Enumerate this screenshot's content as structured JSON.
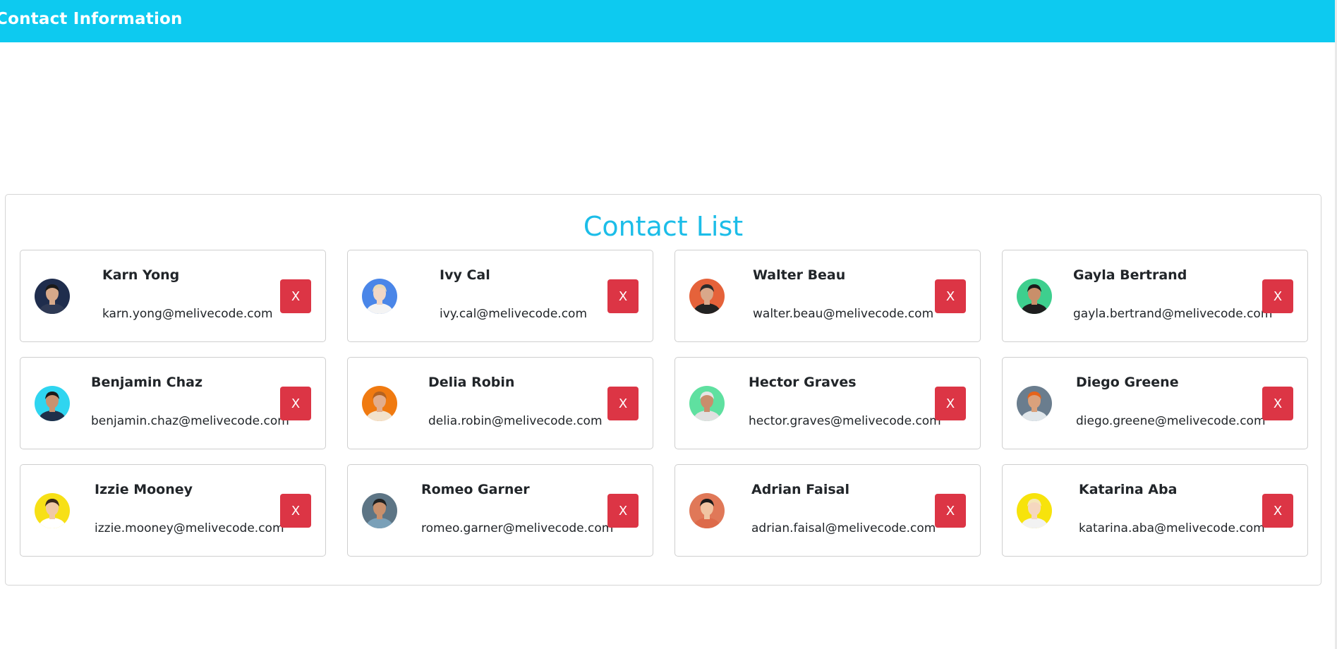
{
  "header": {
    "title": "Contact Information",
    "bg_color": "#0dcaf0"
  },
  "panel": {
    "title": "Contact List",
    "title_color": "#1cbde8"
  },
  "delete_label": "X",
  "delete_color": "#dc3545",
  "contacts": [
    {
      "name": "Karn Yong",
      "email": "karn.yong@melivecode.com",
      "avatar_bg": "#1f2d4d",
      "skin": "#d7a98a",
      "hair": "#1a1a1a",
      "shirt": "#2f3a55"
    },
    {
      "name": "Ivy Cal",
      "email": "ivy.cal@melivecode.com",
      "avatar_bg": "#4a86e8",
      "skin": "#f1d7c6",
      "hair": "#e8d9b8",
      "shirt": "#f4f4f4"
    },
    {
      "name": "Walter Beau",
      "email": "walter.beau@melivecode.com",
      "avatar_bg": "#e5623a",
      "skin": "#d9a88a",
      "hair": "#2b2b2b",
      "shirt": "#222222"
    },
    {
      "name": "Gayla Bertrand",
      "email": "gayla.bertrand@melivecode.com",
      "avatar_bg": "#3ecf8e",
      "skin": "#c98f6a",
      "hair": "#1b1b1b",
      "shirt": "#1e1e1e"
    },
    {
      "name": "Benjamin Chaz",
      "email": "benjamin.chaz@melivecode.com",
      "avatar_bg": "#2fd5f0",
      "skin": "#c99270",
      "hair": "#1a1a1a",
      "shirt": "#1f2f4a"
    },
    {
      "name": "Delia Robin",
      "email": "delia.robin@melivecode.com",
      "avatar_bg": "#f07a10",
      "skin": "#e2ad8c",
      "hair": "#b5621f",
      "shirt": "#f2e2cc"
    },
    {
      "name": "Hector Graves",
      "email": "hector.graves@melivecode.com",
      "avatar_bg": "#5fe0a0",
      "skin": "#c98d6c",
      "hair": "#e5e5e5",
      "shirt": "#e0e0e0"
    },
    {
      "name": "Diego Greene",
      "email": "diego.greene@melivecode.com",
      "avatar_bg": "#6a7d8e",
      "skin": "#d9a17c",
      "hair": "#e5631a",
      "shirt": "#e0e6ea"
    },
    {
      "name": "Izzie Mooney",
      "email": "izzie.mooney@melivecode.com",
      "avatar_bg": "#f7e016",
      "skin": "#f0c9a6",
      "hair": "#3b2a1d",
      "shirt": "#ffffff"
    },
    {
      "name": "Romeo Garner",
      "email": "romeo.garner@melivecode.com",
      "avatar_bg": "#5d7585",
      "skin": "#c9906c",
      "hair": "#202020",
      "shirt": "#7aa0b8"
    },
    {
      "name": "Adrian Faisal",
      "email": "adrian.faisal@melivecode.com",
      "avatar_bg": "#e07858",
      "skin": "#f0c4a2",
      "hair": "#1a1a1a",
      "shirt": "#dd6a4a"
    },
    {
      "name": "Katarina Aba",
      "email": "katarina.aba@melivecode.com",
      "avatar_bg": "#f7e30c",
      "skin": "#f5d7bf",
      "hair": "#f4e7b8",
      "shirt": "#f2f2f2"
    }
  ]
}
